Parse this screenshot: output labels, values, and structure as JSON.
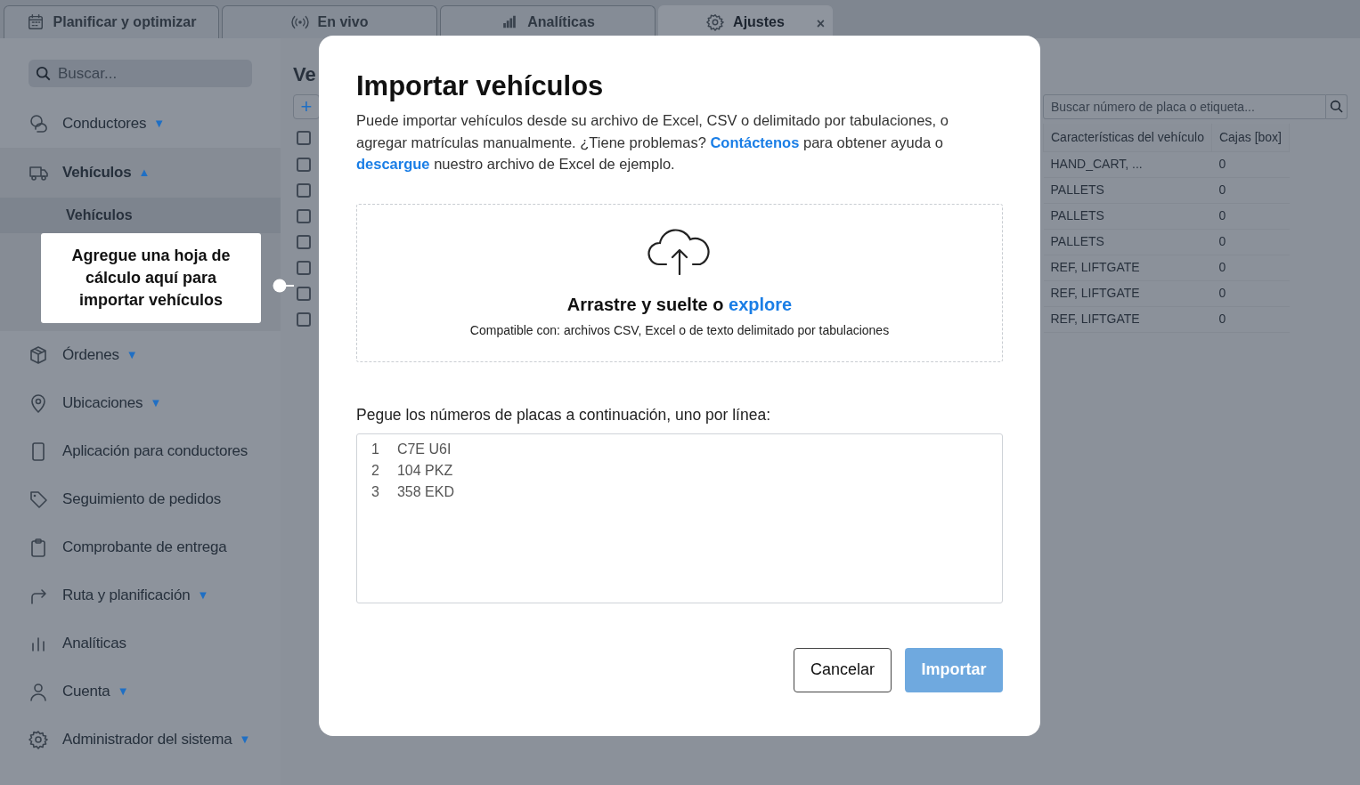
{
  "tabs": [
    {
      "kind": "calendar",
      "label": "Planificar y optimizar",
      "selected": false
    },
    {
      "kind": "broadcast",
      "label": "En vivo",
      "selected": false
    },
    {
      "kind": "bars",
      "label": "Analíticas",
      "selected": false
    },
    {
      "kind": "gear",
      "label": "Ajustes",
      "selected": true,
      "close": "×"
    }
  ],
  "sidebar": {
    "search": {
      "placeholder": "Buscar..."
    },
    "items": [
      {
        "kind": "person",
        "label": "Conductores",
        "caret": "▼",
        "selected": false
      },
      {
        "kind": "truck",
        "label": "Vehículos",
        "caret": "▲",
        "selected": true,
        "children": [
          {
            "label": "Vehículos"
          }
        ]
      },
      {
        "kind": "box",
        "label": "Órdenes",
        "caret": "▼",
        "selected": false
      },
      {
        "kind": "pin",
        "label": "Ubicaciones",
        "caret": "▼",
        "selected": false
      },
      {
        "kind": "phone",
        "label": "Aplicación para conductores",
        "selected": false
      },
      {
        "kind": "tag",
        "label": "Seguimiento de pedidos",
        "selected": false
      },
      {
        "kind": "clipboard",
        "label": "Comprobante de entrega",
        "selected": false
      },
      {
        "kind": "route",
        "label": "Ruta y planificación",
        "caret": "▼",
        "selected": false
      },
      {
        "kind": "chart",
        "label": "Analíticas",
        "selected": false
      },
      {
        "kind": "user",
        "label": "Cuenta",
        "caret": "▼",
        "selected": false
      },
      {
        "kind": "gear",
        "label": "Administrador del sistema",
        "caret": "▼",
        "selected": false
      }
    ]
  },
  "main": {
    "heading": "Ve",
    "add_button": "+",
    "search": {
      "placeholder": "Buscar número de placa o etiqueta..."
    },
    "table": {
      "columns": [
        "Características del vehículo",
        "Cajas [box]"
      ],
      "header_checked": false,
      "rows": [
        {
          "checked": false,
          "cells": [
            "HAND_CART, ...",
            "0"
          ]
        },
        {
          "checked": false,
          "cells": [
            "PALLETS",
            "0"
          ]
        },
        {
          "checked": false,
          "cells": [
            "PALLETS",
            "0"
          ]
        },
        {
          "checked": false,
          "cells": [
            "PALLETS",
            "0"
          ]
        },
        {
          "checked": false,
          "cells": [
            "REF, LIFTGATE",
            "0"
          ]
        },
        {
          "checked": false,
          "cells": [
            "REF, LIFTGATE",
            "0"
          ]
        },
        {
          "checked": false,
          "cells": [
            "REF, LIFTGATE",
            "0"
          ]
        }
      ]
    }
  },
  "tooltip": "Agregue una hoja de cálculo aquí para importar vehículos",
  "modal": {
    "title": "Importar vehículos",
    "description": [
      {
        "kind": "text",
        "text": "Puede importar vehículos desde su archivo de Excel, CSV o delimitado por tabulaciones, o agregar matrículas manualmente. ¿Tiene problemas?"
      },
      {
        "kind": "link",
        "text": "Contáctenos"
      },
      {
        "kind": "text",
        "text": "para obtener ayuda o"
      },
      {
        "kind": "link",
        "text": "descargue"
      },
      {
        "kind": "text",
        "text": "nuestro archivo de Excel de ejemplo."
      }
    ],
    "dropzone": {
      "text": "Arrastre y suelte o",
      "link": "explore",
      "note": "Compatible con: archivos CSV, Excel o de texto delimitado por tabulaciones"
    },
    "paste_label": "Pegue los números de placas a continuación, uno por línea:",
    "plates": [
      {
        "number": "1",
        "text": "C7E U6I"
      },
      {
        "number": "2",
        "text": "104 PKZ"
      },
      {
        "number": "3",
        "text": "358 EKD"
      }
    ],
    "buttons": [
      {
        "kind": "secondary",
        "label": "Cancelar"
      },
      {
        "kind": "primary",
        "label": "Importar",
        "disabled": true
      }
    ]
  }
}
